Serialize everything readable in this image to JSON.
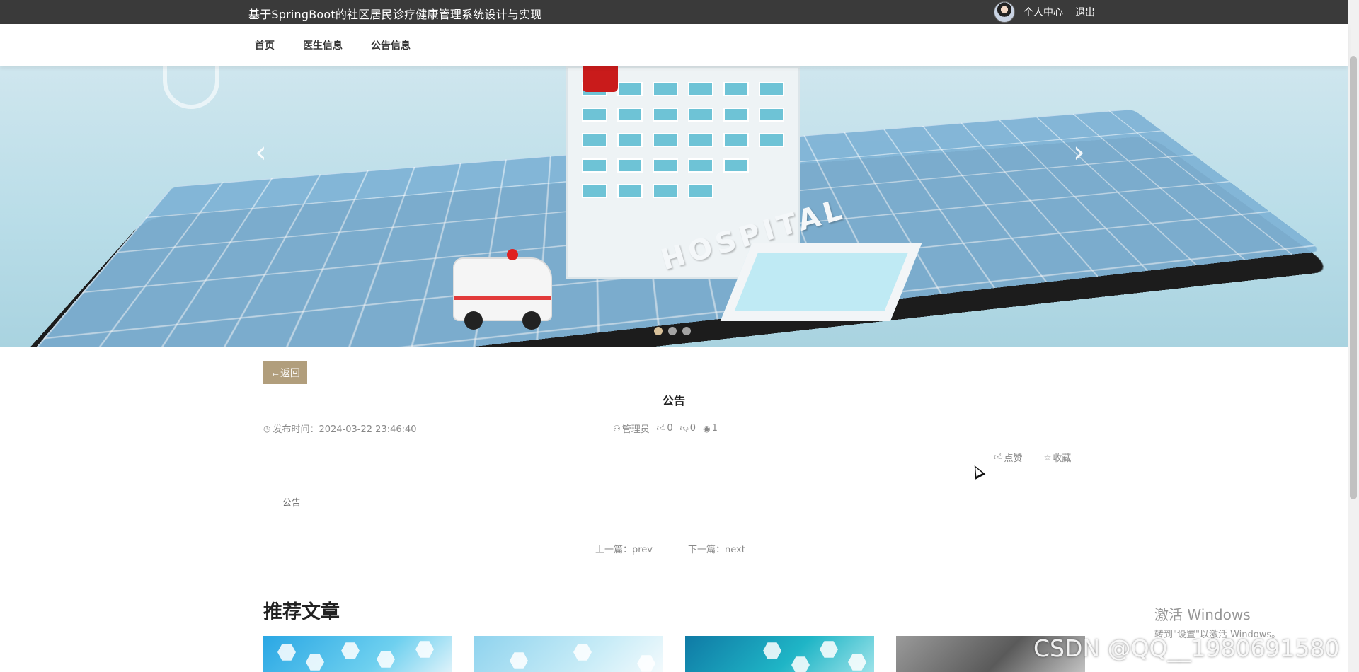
{
  "header": {
    "site_title": "基于SpringBoot的社区居民诊疗健康管理系统设计与实现",
    "personal_center": "个人中心",
    "logout": "退出"
  },
  "nav": {
    "items": [
      {
        "label": "首页"
      },
      {
        "label": "医生信息"
      },
      {
        "label": "公告信息"
      }
    ]
  },
  "banner": {
    "hospital_sign": "HOSPITAL",
    "prev_arrow": "‹",
    "next_arrow": "›",
    "slide_count": 3,
    "active_slide": 1
  },
  "article": {
    "back_label": "←返回",
    "title": "公告",
    "publish_label": "发布时间：2024-03-22 23:46:40",
    "author": "管理员",
    "likes": "0",
    "dislikes": "0",
    "views": "1",
    "like_action": "点赞",
    "favorite_action": "收藏",
    "body": "公告",
    "prev": "上一篇：prev",
    "next": "下一篇：next"
  },
  "recommended": {
    "title": "推荐文章",
    "cards": 4
  },
  "overlay": {
    "activation_title": "激活 Windows",
    "activation_sub": "转到\"设置\"以激活 Windows。",
    "csdn_watermark": "CSDN @QQ__1980691580"
  },
  "icons": {
    "clock": "clock-icon",
    "user": "user-icon",
    "thumb_up": "thumb-up-icon",
    "thumb_down": "thumb-down-icon",
    "eye": "eye-icon",
    "star": "star-icon"
  }
}
